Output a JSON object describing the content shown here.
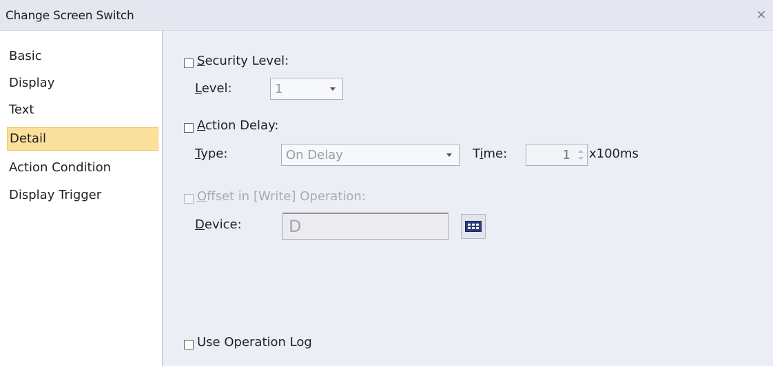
{
  "window": {
    "title": "Change Screen Switch",
    "close_glyph": "×"
  },
  "sidebar": {
    "items": [
      {
        "label": "Basic",
        "selected": false
      },
      {
        "label": "Display",
        "selected": false
      },
      {
        "label": "Text",
        "selected": false
      },
      {
        "label": "Detail",
        "selected": true
      },
      {
        "label": "Action Condition",
        "selected": false
      },
      {
        "label": "Display Trigger",
        "selected": false
      }
    ]
  },
  "detail": {
    "security_level": {
      "checkbox_label_key": "S",
      "checkbox_label_rest": "ecurity Level:",
      "checked": false,
      "level_label_key": "L",
      "level_label_rest": "evel:",
      "level_value": "1"
    },
    "action_delay": {
      "checkbox_label_key": "A",
      "checkbox_label_rest": "ction Delay:",
      "checked": false,
      "type_label_key": "T",
      "type_label_rest": "ype:",
      "type_value": "On Delay",
      "time_label_pre": "T",
      "time_label_key": "i",
      "time_label_rest": "me:",
      "time_value": "1",
      "time_unit": "x100ms"
    },
    "offset_write": {
      "checkbox_label_key": "O",
      "checkbox_label_rest": "ffset in [Write] Operation:",
      "checked": false,
      "disabled": true,
      "device_label_key": "D",
      "device_label_rest": "evice:",
      "device_value": "D"
    },
    "use_operation_log": {
      "label": "Use Operation Log",
      "checked": false
    }
  },
  "colors": {
    "titlebar_bg": "#e4e6f0",
    "content_bg": "#eceef5",
    "selected_item_bg": "#fbe09b",
    "device_icon": "#2b3d7a"
  },
  "icons": {
    "close": "close-icon",
    "device_browse": "device-browser-icon",
    "dropdown": "chevron-down-icon"
  }
}
